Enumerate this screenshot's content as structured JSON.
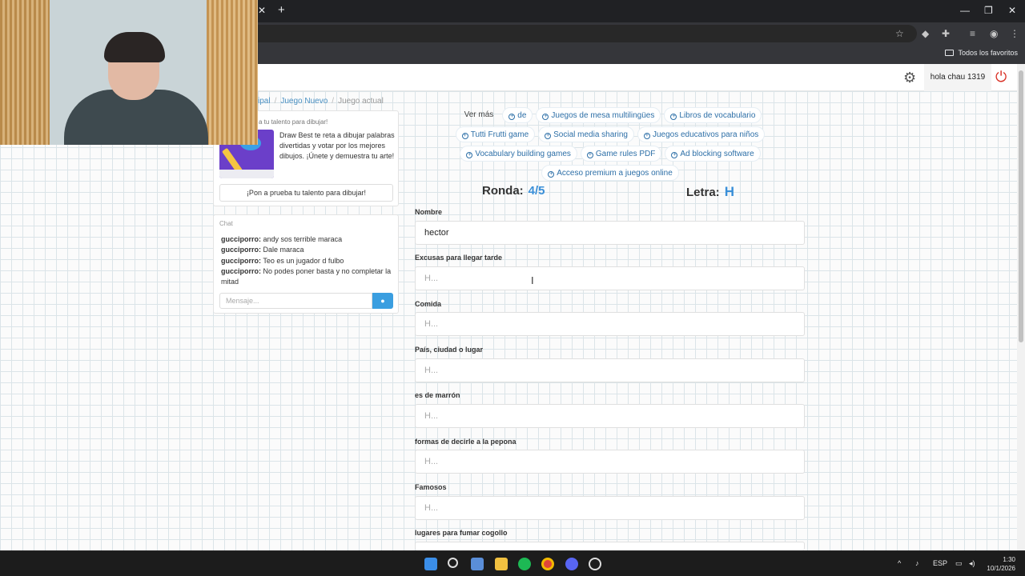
{
  "browser": {
    "bookmarks_folder": "Todos los favoritos"
  },
  "header": {
    "user_button": "hola chau 1319"
  },
  "breadcrumb": {
    "items": [
      "ipal",
      "Juego Nuevo",
      "Juego actual"
    ]
  },
  "promo": {
    "title": "a tu talento para dibujar!",
    "text": "Draw Best te reta a dibujar palabras divertidas y votar por los mejores dibujos. ¡Únete y demuestra tu arte!",
    "button": "¡Pon a prueba tu talento para dibujar!"
  },
  "chat": {
    "title": "Chat",
    "messages": [
      {
        "user": "gucciporro:",
        "text": "andy sos terrible maraca"
      },
      {
        "user": "gucciporro:",
        "text": "Dale maraca"
      },
      {
        "user": "gucciporro:",
        "text": "Teo es un jugador d fulbo"
      },
      {
        "user": "gucciporro:",
        "text": "No podes poner basta y no completar la mitad"
      }
    ],
    "input_placeholder": "Mensaje..."
  },
  "tags": {
    "label": "Ver más",
    "rows": [
      [
        "de",
        "Juegos de mesa multilingües",
        "Libros de vocabulario"
      ],
      [
        "Tutti Frutti game",
        "Social media sharing",
        "Juegos educativos para niños"
      ],
      [
        "Vocabulary building games",
        "Game rules PDF",
        "Ad blocking software"
      ],
      [
        "Acceso premium a juegos online"
      ]
    ]
  },
  "game": {
    "round_label": "Ronda:",
    "round_value": "4/5",
    "letter_label": "Letra:",
    "letter_value": "H"
  },
  "form": {
    "fields": [
      {
        "label": "Nombre",
        "value": "hector",
        "placeholder": ""
      },
      {
        "label": "Excusas para llegar tarde",
        "value": "",
        "placeholder": "H..."
      },
      {
        "label": "Comida",
        "value": "",
        "placeholder": "H..."
      },
      {
        "label": "País, ciudad o lugar",
        "value": "",
        "placeholder": "H..."
      },
      {
        "label": "es de marrón",
        "value": "",
        "placeholder": "H..."
      },
      {
        "label": "formas de decirle a la pepona",
        "value": "",
        "placeholder": "H..."
      },
      {
        "label": "Famosos",
        "value": "",
        "placeholder": "H..."
      },
      {
        "label": "lugares para fumar cogollo",
        "value": "",
        "placeholder": ""
      }
    ]
  },
  "taskbar": {
    "language": "ESP",
    "time": "1:30",
    "date": "10/1/2026"
  },
  "colors": {
    "accent": "#3a8fd8",
    "tag_text": "#2d6fa7",
    "power": "#d93025"
  }
}
